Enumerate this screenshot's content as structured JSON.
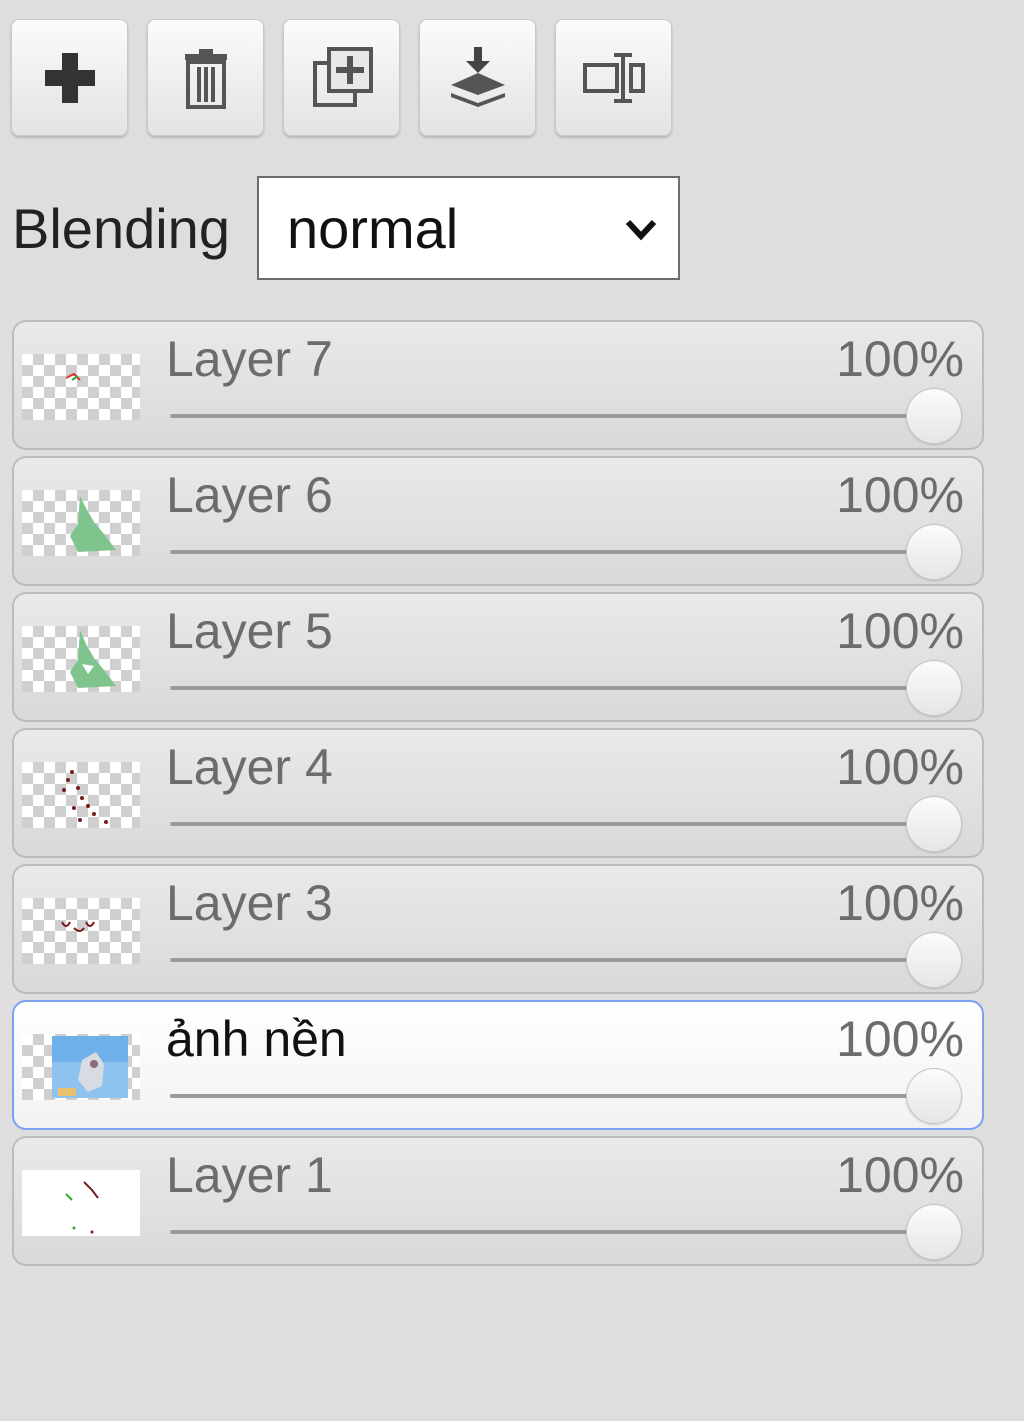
{
  "toolbar": {
    "buttons": [
      {
        "icon": "plus-icon"
      },
      {
        "icon": "trash-icon"
      },
      {
        "icon": "duplicate-icon"
      },
      {
        "icon": "merge-down-icon"
      },
      {
        "icon": "rename-icon"
      }
    ]
  },
  "blending": {
    "label": "Blending",
    "value": "normal"
  },
  "layers": [
    {
      "name": "Layer 7",
      "opacity_label": "100%",
      "opacity": 1.0,
      "selected": false
    },
    {
      "name": "Layer 6",
      "opacity_label": "100%",
      "opacity": 1.0,
      "selected": false
    },
    {
      "name": "Layer 5",
      "opacity_label": "100%",
      "opacity": 1.0,
      "selected": false
    },
    {
      "name": "Layer 4",
      "opacity_label": "100%",
      "opacity": 1.0,
      "selected": false
    },
    {
      "name": "Layer 3",
      "opacity_label": "100%",
      "opacity": 1.0,
      "selected": false
    },
    {
      "name": "ảnh nền",
      "opacity_label": "100%",
      "opacity": 1.0,
      "selected": true
    },
    {
      "name": "Layer 1",
      "opacity_label": "100%",
      "opacity": 1.0,
      "selected": false
    }
  ]
}
